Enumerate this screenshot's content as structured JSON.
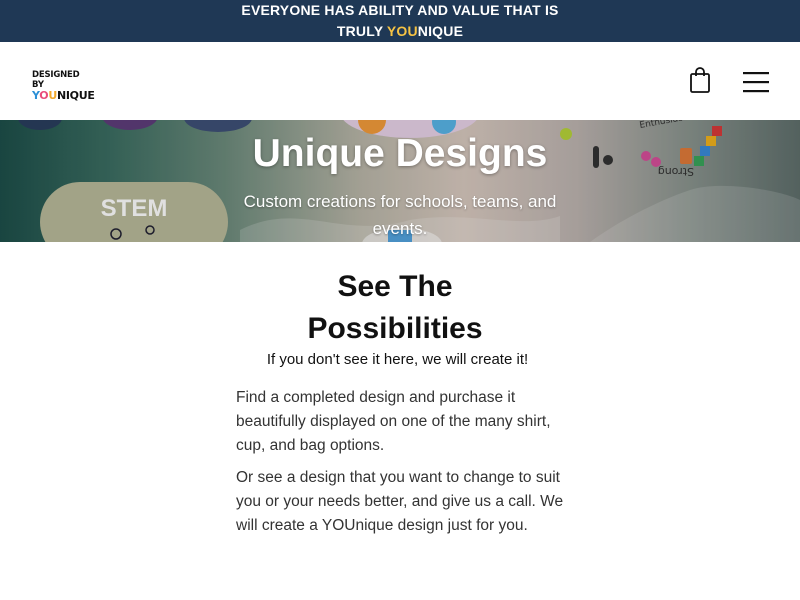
{
  "announcement": {
    "line1": "EVERYONE HAS ABILITY AND VALUE THAT IS",
    "line2_prefix": "TRULY ",
    "line2_highlight": "YOU",
    "line2_suffix": "NIQUE"
  },
  "header": {
    "logo_line1": "DESIGNED BY",
    "logo_you": [
      "Y",
      "O",
      "U"
    ],
    "logo_rest": "NIQUE",
    "cart_icon": "shopping-bag-icon",
    "menu_icon": "hamburger-menu-icon"
  },
  "hero": {
    "title": "Unique Designs",
    "subtitle": "Custom creations for schools, teams, and events.",
    "badge_text": "STEM",
    "sticker_text": "Strong",
    "sticker_text2": "Enthusiastic"
  },
  "section": {
    "title": "See The Possibilities",
    "subtitle": "If you don't see it here, we will create it!",
    "paragraph1": "Find a completed design and purchase it beautifully displayed on one of the many shirt, cup, and bag options.",
    "paragraph2": "Or see a design that you want to change to suit you or your needs better, and give us a call. We will create a YOUnique design just for you."
  },
  "colors": {
    "announcement_bg": "#1f3855",
    "announcement_highlight": "#f6c344",
    "text": "#111111"
  }
}
